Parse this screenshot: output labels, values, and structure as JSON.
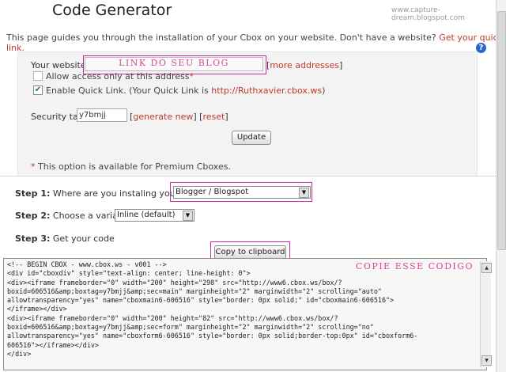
{
  "header": {
    "title": "Code Generator",
    "watermark": "www.capture-dream.blogspot.com"
  },
  "intro": {
    "text": "This page guides you through the installation of your Cbox on your website. Don't have a website?",
    "link": "Get your quick link."
  },
  "site": {
    "label": "Your website:",
    "value": "LINK DO SEU BLOG",
    "more_open": "[",
    "more_link": "more addresses",
    "more_close": "]"
  },
  "options": {
    "allow_label": "Allow access only at this address",
    "allow_mark": "*",
    "quick_prefix": "Enable Quick Link. (Your Quick Link is",
    "quick_link": "http://Ruthxavier.cbox.ws",
    "quick_suffix": ")",
    "check_glyph": "✔"
  },
  "security": {
    "label": "Security tag:",
    "value": "y7bmjj",
    "open1": "[",
    "generate": "generate new",
    "close1": "] [",
    "reset": "reset",
    "close2": "]"
  },
  "update_label": "Update",
  "premium": {
    "mark": "*",
    "text": " This option is available for Premium Cboxes."
  },
  "steps": {
    "step1_num": "Step 1:",
    "step1_text": " Where are you instaling your Cbox?",
    "step1_value": "Blogger / Blogspot",
    "step2_num": "Step 2:",
    "step2_text": " Choose a variation:",
    "step2_value": "Inline (default)",
    "step3_num": "Step 3:",
    "step3_text": " Get your code"
  },
  "copy_label": "Copy to clipboard",
  "code": {
    "note": "COPIE ESSE CODIGO",
    "text": "<!-- BEGIN CBOX - www.cbox.ws - v001 -->\n<div id=\"cboxdiv\" style=\"text-align: center; line-height: 0\">\n<div><iframe frameborder=\"0\" width=\"200\" height=\"298\" src=\"http://www6.cbox.ws/box/?\nboxid=606516&amp;boxtag=y7bmjj&amp;sec=main\" marginheight=\"2\" marginwidth=\"2\" scrolling=\"auto\"\nallowtransparency=\"yes\" name=\"cboxmain6-606516\" style=\"border: 0px solid;\" id=\"cboxmain6-606516\">\n</iframe></div>\n<div><iframe frameborder=\"0\" width=\"200\" height=\"82\" src=\"http://www6.cbox.ws/box/?\nboxid=606516&amp;boxtag=y7bmjj&amp;sec=form\" marginheight=\"2\" marginwidth=\"2\" scrolling=\"no\"\nallowtransparency=\"yes\" name=\"cboxform6-606516\" style=\"border: 0px solid;border-top:0px\" id=\"cboxform6-\n606516\"></iframe></div>\n</div>"
  },
  "icons": {
    "help": "?",
    "dropdown": "▼",
    "scroll_up": "▲",
    "scroll_down": "▼"
  }
}
